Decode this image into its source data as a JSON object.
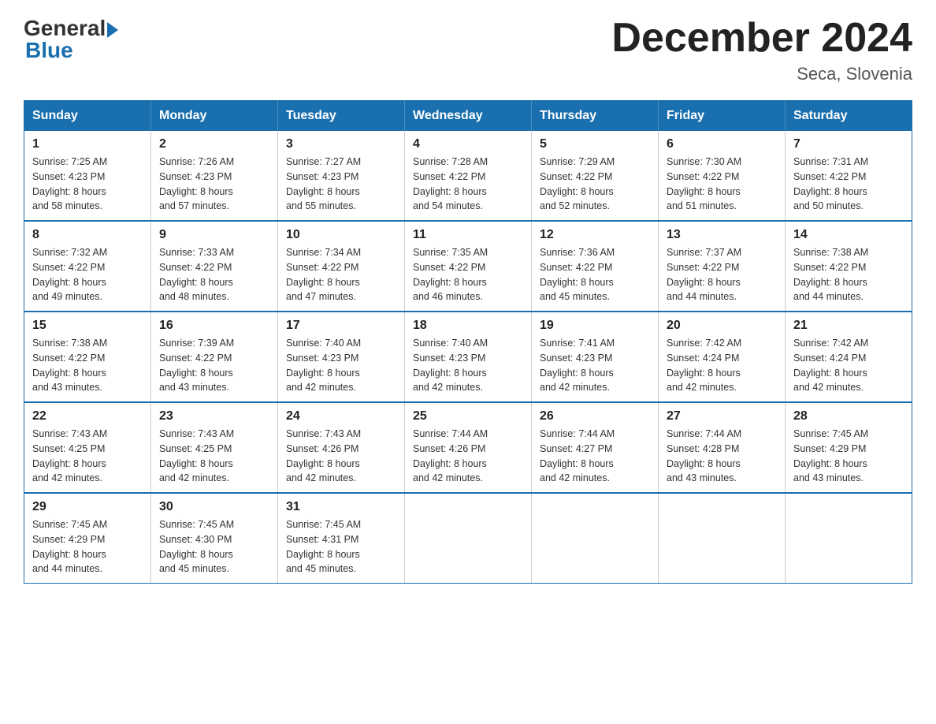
{
  "logo": {
    "general": "General",
    "blue": "Blue"
  },
  "header": {
    "title": "December 2024",
    "location": "Seca, Slovenia"
  },
  "weekdays": [
    "Sunday",
    "Monday",
    "Tuesday",
    "Wednesday",
    "Thursday",
    "Friday",
    "Saturday"
  ],
  "weeks": [
    [
      {
        "day": "1",
        "sunrise": "7:25 AM",
        "sunset": "4:23 PM",
        "daylight": "8 hours and 58 minutes."
      },
      {
        "day": "2",
        "sunrise": "7:26 AM",
        "sunset": "4:23 PM",
        "daylight": "8 hours and 57 minutes."
      },
      {
        "day": "3",
        "sunrise": "7:27 AM",
        "sunset": "4:23 PM",
        "daylight": "8 hours and 55 minutes."
      },
      {
        "day": "4",
        "sunrise": "7:28 AM",
        "sunset": "4:22 PM",
        "daylight": "8 hours and 54 minutes."
      },
      {
        "day": "5",
        "sunrise": "7:29 AM",
        "sunset": "4:22 PM",
        "daylight": "8 hours and 52 minutes."
      },
      {
        "day": "6",
        "sunrise": "7:30 AM",
        "sunset": "4:22 PM",
        "daylight": "8 hours and 51 minutes."
      },
      {
        "day": "7",
        "sunrise": "7:31 AM",
        "sunset": "4:22 PM",
        "daylight": "8 hours and 50 minutes."
      }
    ],
    [
      {
        "day": "8",
        "sunrise": "7:32 AM",
        "sunset": "4:22 PM",
        "daylight": "8 hours and 49 minutes."
      },
      {
        "day": "9",
        "sunrise": "7:33 AM",
        "sunset": "4:22 PM",
        "daylight": "8 hours and 48 minutes."
      },
      {
        "day": "10",
        "sunrise": "7:34 AM",
        "sunset": "4:22 PM",
        "daylight": "8 hours and 47 minutes."
      },
      {
        "day": "11",
        "sunrise": "7:35 AM",
        "sunset": "4:22 PM",
        "daylight": "8 hours and 46 minutes."
      },
      {
        "day": "12",
        "sunrise": "7:36 AM",
        "sunset": "4:22 PM",
        "daylight": "8 hours and 45 minutes."
      },
      {
        "day": "13",
        "sunrise": "7:37 AM",
        "sunset": "4:22 PM",
        "daylight": "8 hours and 44 minutes."
      },
      {
        "day": "14",
        "sunrise": "7:38 AM",
        "sunset": "4:22 PM",
        "daylight": "8 hours and 44 minutes."
      }
    ],
    [
      {
        "day": "15",
        "sunrise": "7:38 AM",
        "sunset": "4:22 PM",
        "daylight": "8 hours and 43 minutes."
      },
      {
        "day": "16",
        "sunrise": "7:39 AM",
        "sunset": "4:22 PM",
        "daylight": "8 hours and 43 minutes."
      },
      {
        "day": "17",
        "sunrise": "7:40 AM",
        "sunset": "4:23 PM",
        "daylight": "8 hours and 42 minutes."
      },
      {
        "day": "18",
        "sunrise": "7:40 AM",
        "sunset": "4:23 PM",
        "daylight": "8 hours and 42 minutes."
      },
      {
        "day": "19",
        "sunrise": "7:41 AM",
        "sunset": "4:23 PM",
        "daylight": "8 hours and 42 minutes."
      },
      {
        "day": "20",
        "sunrise": "7:42 AM",
        "sunset": "4:24 PM",
        "daylight": "8 hours and 42 minutes."
      },
      {
        "day": "21",
        "sunrise": "7:42 AM",
        "sunset": "4:24 PM",
        "daylight": "8 hours and 42 minutes."
      }
    ],
    [
      {
        "day": "22",
        "sunrise": "7:43 AM",
        "sunset": "4:25 PM",
        "daylight": "8 hours and 42 minutes."
      },
      {
        "day": "23",
        "sunrise": "7:43 AM",
        "sunset": "4:25 PM",
        "daylight": "8 hours and 42 minutes."
      },
      {
        "day": "24",
        "sunrise": "7:43 AM",
        "sunset": "4:26 PM",
        "daylight": "8 hours and 42 minutes."
      },
      {
        "day": "25",
        "sunrise": "7:44 AM",
        "sunset": "4:26 PM",
        "daylight": "8 hours and 42 minutes."
      },
      {
        "day": "26",
        "sunrise": "7:44 AM",
        "sunset": "4:27 PM",
        "daylight": "8 hours and 42 minutes."
      },
      {
        "day": "27",
        "sunrise": "7:44 AM",
        "sunset": "4:28 PM",
        "daylight": "8 hours and 43 minutes."
      },
      {
        "day": "28",
        "sunrise": "7:45 AM",
        "sunset": "4:29 PM",
        "daylight": "8 hours and 43 minutes."
      }
    ],
    [
      {
        "day": "29",
        "sunrise": "7:45 AM",
        "sunset": "4:29 PM",
        "daylight": "8 hours and 44 minutes."
      },
      {
        "day": "30",
        "sunrise": "7:45 AM",
        "sunset": "4:30 PM",
        "daylight": "8 hours and 45 minutes."
      },
      {
        "day": "31",
        "sunrise": "7:45 AM",
        "sunset": "4:31 PM",
        "daylight": "8 hours and 45 minutes."
      },
      null,
      null,
      null,
      null
    ]
  ],
  "labels": {
    "sunrise": "Sunrise:",
    "sunset": "Sunset:",
    "daylight": "Daylight:"
  }
}
